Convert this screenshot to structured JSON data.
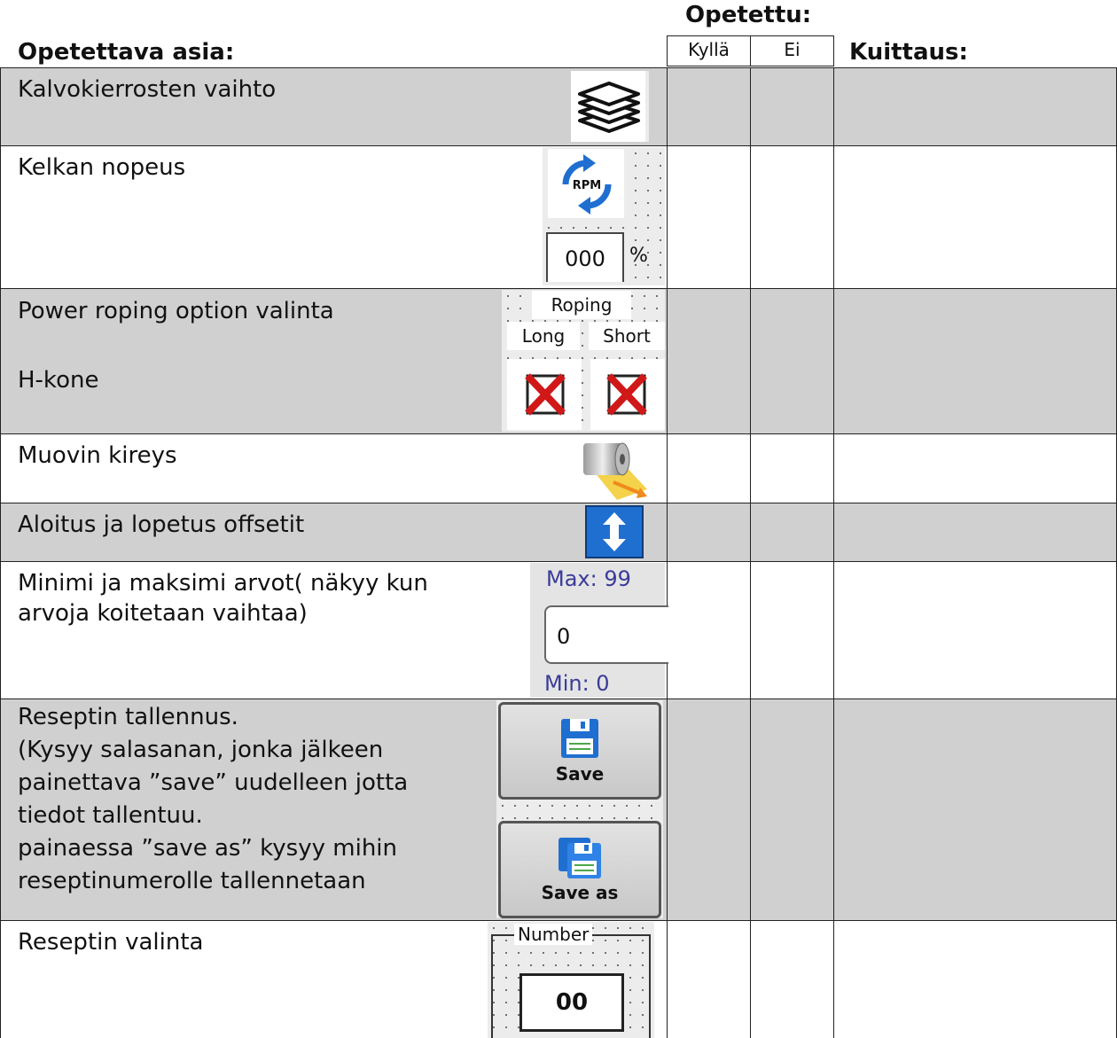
{
  "header": {
    "topic_label": "Opetettava asia:",
    "taught_label": "Opetettu:",
    "yes_label": "Kyllä",
    "no_label": "Ei",
    "ack_label": "Kuittaus:"
  },
  "rows": [
    {
      "text": "Kalvokierrosten vaihto",
      "icon": "layers-icon"
    },
    {
      "text": "Kelkan nopeus",
      "icon": "rpm-icon",
      "value": "000",
      "unit": "%"
    },
    {
      "text": "Power roping option valinta",
      "text2": "H-kone",
      "group_label": "Roping",
      "long_label": "Long",
      "short_label": "Short",
      "icon": "cross-icon"
    },
    {
      "text": "Muovin kireys",
      "icon": "film-roll-icon"
    },
    {
      "text": "Aloitus ja lopetus offsetit",
      "icon": "up-down-arrow-icon"
    },
    {
      "text": "Minimi ja maksimi arvot( näkyy kun arvoja koitetaan vaihtaa)",
      "max_label": "Max: 99",
      "value": "0",
      "min_label": "Min: 0"
    },
    {
      "text_lines": [
        "Reseptin tallennus.",
        "(Kysyy salasanan, jonka jälkeen",
        "painettava ”save” uudelleen jotta",
        "tiedot tallentuu.",
        "painaessa ”save as” kysyy mihin",
        "reseptinumerolle tallennetaan"
      ],
      "save_label": "Save",
      "save_as_label": "Save as",
      "icon": "floppy-disk-icon"
    },
    {
      "text": "Reseptin valinta",
      "group_label": "Number",
      "value": "00"
    }
  ],
  "colors": {
    "gray_row": "#d0d0d0",
    "accent_blue": "#1f6fd1"
  }
}
